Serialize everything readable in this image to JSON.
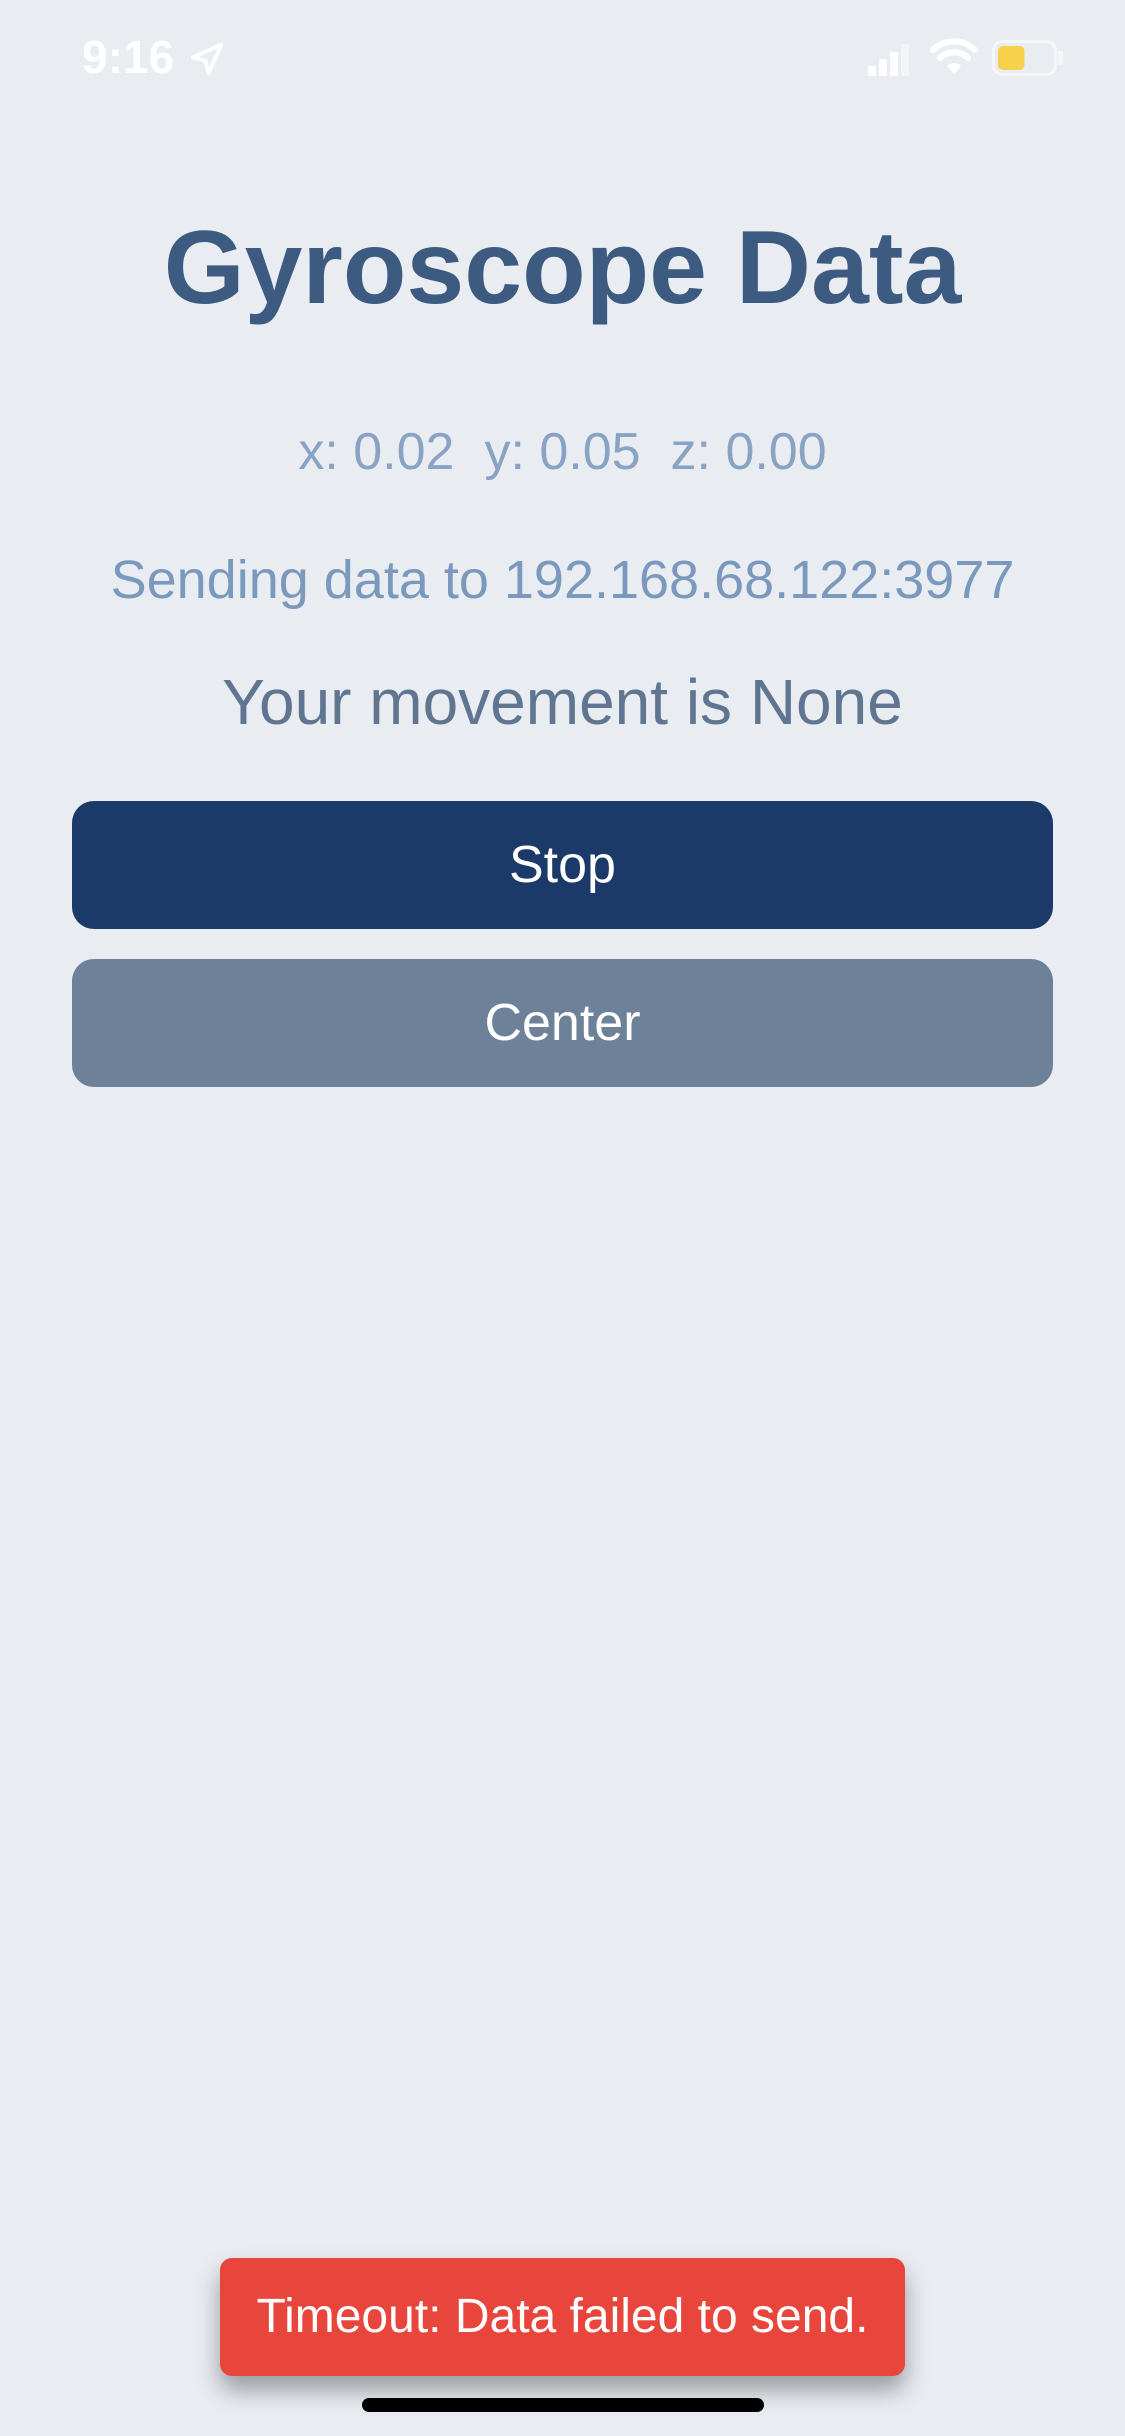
{
  "status_bar": {
    "time": "9:16",
    "location_icon": "location-arrow-icon",
    "signal_icon": "cellular-signal-icon",
    "wifi_icon": "wifi-icon",
    "battery_icon": "battery-icon",
    "battery_color": "#f7d14c",
    "battery_level": 0.5
  },
  "main": {
    "title": "Gyroscope Data",
    "gyro": {
      "x": "x: 0.02",
      "y": "y: 0.05",
      "z": "z: 0.00"
    },
    "sending_info": "Sending data to 192.168.68.122:3977",
    "movement": "Your movement is None",
    "stop_label": "Stop",
    "center_label": "Center"
  },
  "toast": {
    "message": "Timeout: Data failed to send.",
    "color": "#e8453c"
  },
  "colors": {
    "background": "#e9edf2",
    "title": "#3d5a80",
    "stop_button": "#1b3a69",
    "center_button": "#6d8199"
  }
}
